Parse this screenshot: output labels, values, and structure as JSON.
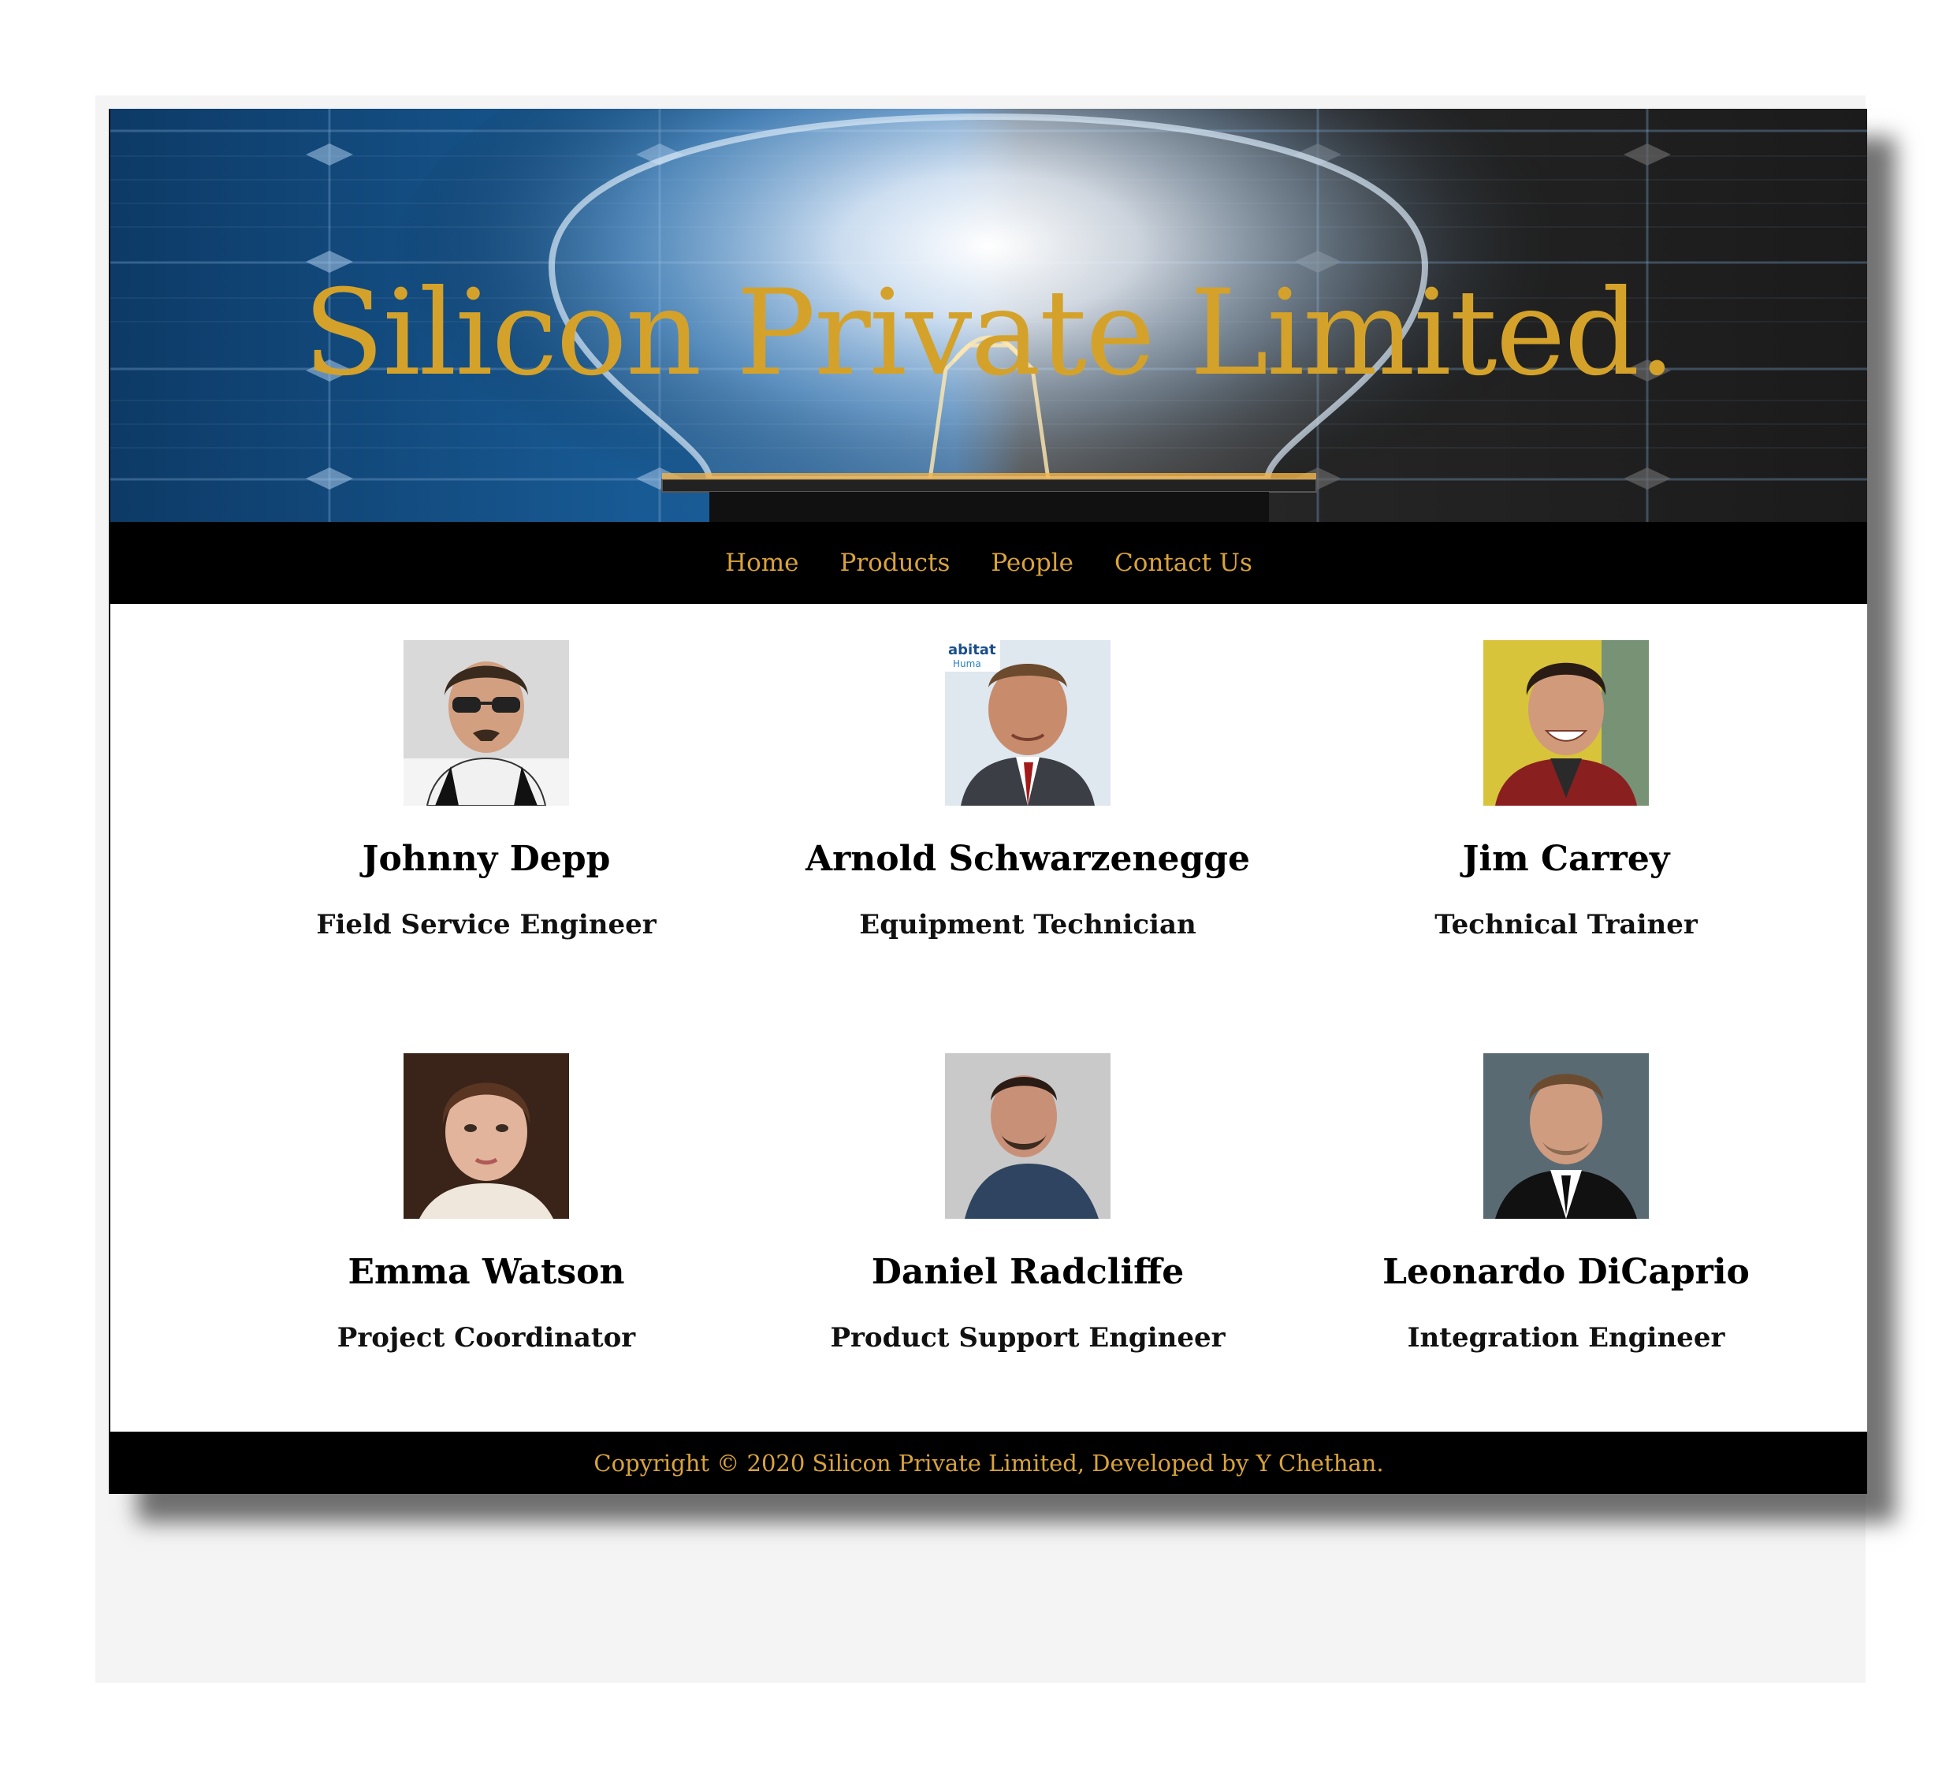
{
  "banner": {
    "title": "Silicon Private Limited.",
    "title_color": "#d4a22a",
    "background_image": "light-bulb-over-solar-panel"
  },
  "nav": {
    "items": [
      {
        "label": "Home"
      },
      {
        "label": "Products"
      },
      {
        "label": "People"
      },
      {
        "label": "Contact Us"
      }
    ],
    "link_color": "#d9a33b"
  },
  "people": [
    {
      "name": "Johnny Depp",
      "role": "Field Service Engineer",
      "photo": "portrait-man-sunglasses"
    },
    {
      "name": "Arnold Schwarzenegge",
      "role": "Equipment Technician",
      "photo": "portrait-man-suit-red-tie"
    },
    {
      "name": "Jim Carrey",
      "role": "Technical Trainer",
      "photo": "portrait-man-red-jacket"
    },
    {
      "name": "Emma Watson",
      "role": "Project Coordinator",
      "photo": "portrait-woman"
    },
    {
      "name": "Daniel Radcliffe",
      "role": "Product Support Engineer",
      "photo": "portrait-man-blue-sweater"
    },
    {
      "name": "Leonardo DiCaprio",
      "role": "Integration Engineer",
      "photo": "portrait-man-black-suit"
    }
  ],
  "footer": {
    "text": "Copyright © 2020 Silicon Private Limited, Developed by Y Chethan."
  }
}
